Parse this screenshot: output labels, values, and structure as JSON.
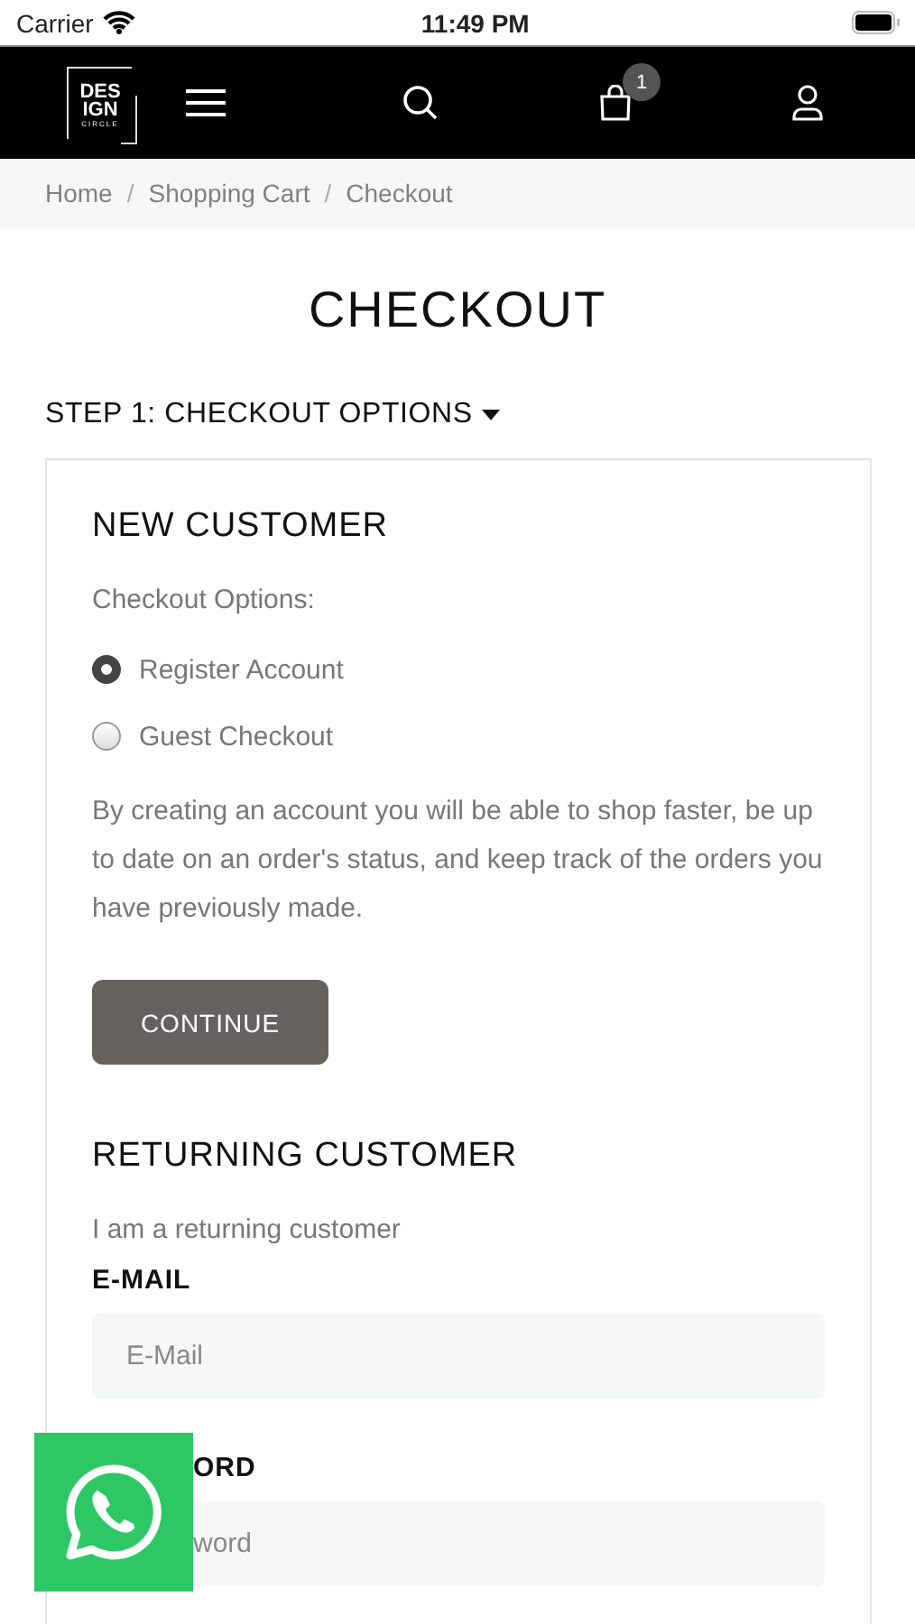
{
  "status_bar": {
    "carrier": "Carrier",
    "time": "11:49 PM"
  },
  "header": {
    "logo_lines": [
      "DES",
      "IGN",
      "CIRCLE"
    ],
    "cart_count": "1"
  },
  "breadcrumb": [
    {
      "kind": "link",
      "text": "Home"
    },
    {
      "kind": "separator",
      "text": "/"
    },
    {
      "kind": "link",
      "text": "Shopping Cart"
    },
    {
      "kind": "separator",
      "text": "/"
    },
    {
      "kind": "link",
      "text": "Checkout"
    }
  ],
  "title": "CHECKOUT",
  "step": {
    "label": "STEP 1: CHECKOUT OPTIONS",
    "expanded": true
  },
  "new_customer": {
    "heading": "NEW CUSTOMER",
    "options_label": "Checkout Options:",
    "options": [
      {
        "label": "Register Account",
        "selected": true
      },
      {
        "label": "Guest Checkout",
        "selected": false
      }
    ],
    "description": "By creating an account you will be able to shop faster, be up to date on an order's status, and keep track of the orders you have previously made.",
    "button": "CONTINUE"
  },
  "returning_customer": {
    "heading": "RETURNING CUSTOMER",
    "intro": "I am a returning customer",
    "fields": [
      {
        "kind": "open",
        "label": "E-MAIL",
        "placeholder": "E-Mail"
      },
      {
        "kind": "overlapped",
        "label": "ORD",
        "placeholder": "word"
      }
    ]
  }
}
